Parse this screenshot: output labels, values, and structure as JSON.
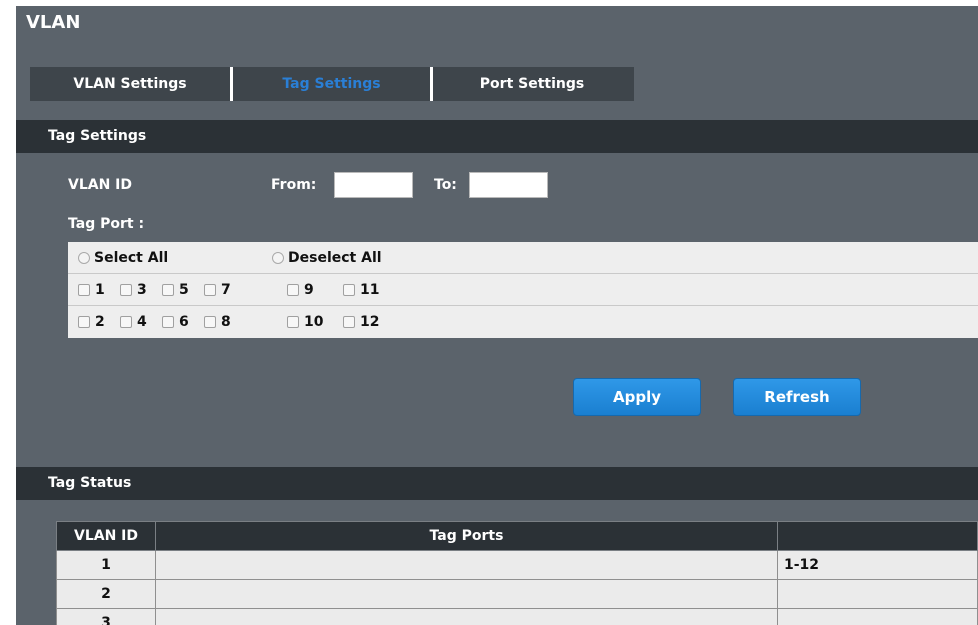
{
  "page_title": "VLAN",
  "tabs": [
    {
      "label": "VLAN Settings",
      "active": false
    },
    {
      "label": "Tag Settings",
      "active": true
    },
    {
      "label": "Port Settings",
      "active": false
    }
  ],
  "tag_settings": {
    "section_title": "Tag Settings",
    "vlan_id_label": "VLAN ID",
    "from_label": "From:",
    "from_value": "",
    "to_label": "To:",
    "to_value": "",
    "tag_port_label": "Tag Port :",
    "select_all_label": "Select All",
    "deselect_all_label": "Deselect All",
    "ports_row1": [
      "1",
      "3",
      "5",
      "7",
      "9",
      "11"
    ],
    "ports_row2": [
      "2",
      "4",
      "6",
      "8",
      "10",
      "12"
    ]
  },
  "buttons": {
    "apply": "Apply",
    "refresh": "Refresh"
  },
  "tag_status": {
    "section_title": "Tag Status",
    "columns": [
      "VLAN ID",
      "Tag Ports",
      ""
    ],
    "rows": [
      {
        "vlan_id": "1",
        "tag_ports": "",
        "col3": "1-12"
      },
      {
        "vlan_id": "2",
        "tag_ports": "",
        "col3": ""
      },
      {
        "vlan_id": "3",
        "tag_ports": "",
        "col3": ""
      }
    ]
  },
  "colors": {
    "background": "#5b636b",
    "section_bar": "#2b3136",
    "active_tab_text": "#2a7fd6",
    "button": "#1f8ae0"
  }
}
